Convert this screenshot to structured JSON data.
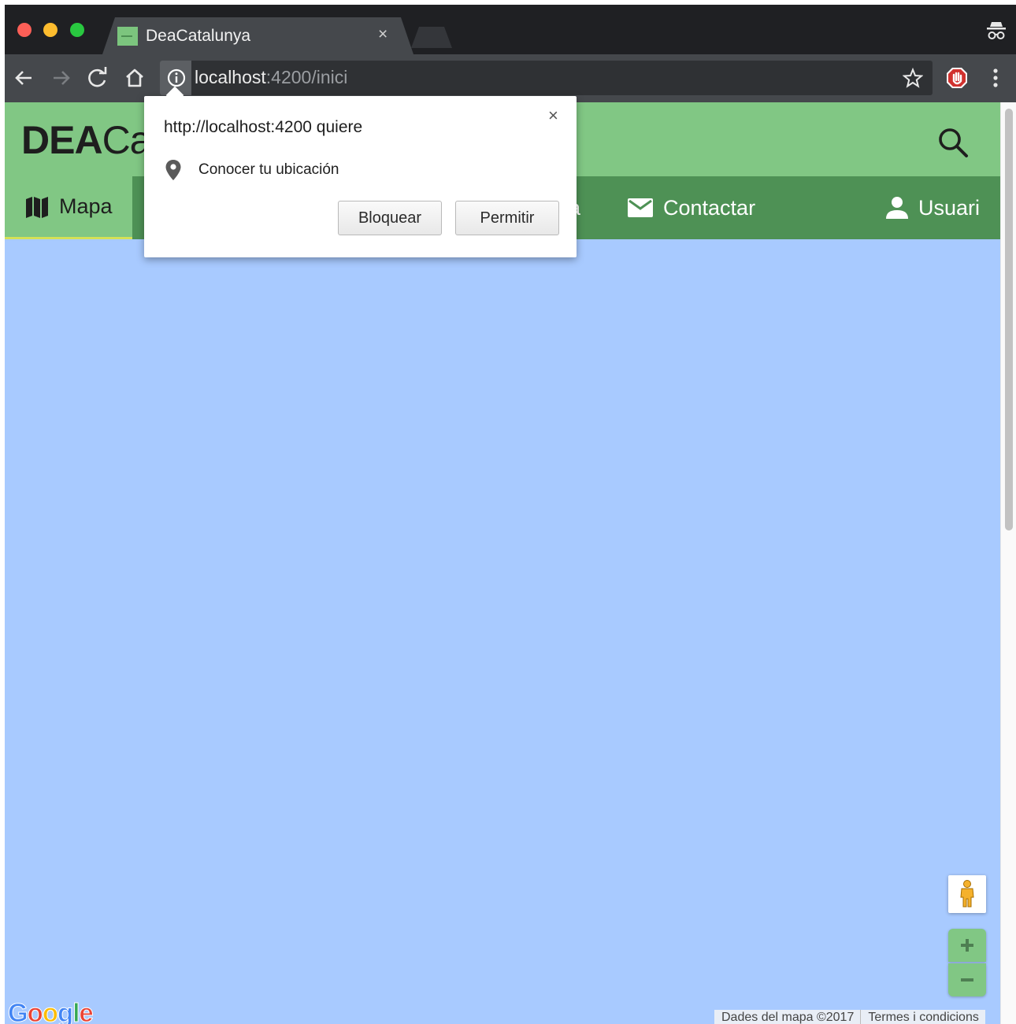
{
  "browser": {
    "tab": {
      "title": "DeaCatalunya",
      "close": "×"
    },
    "address_bar": {
      "host": "localhost",
      "path": ":4200/inici"
    },
    "colors": {
      "titlebar": "#1f2023",
      "toolbar": "#45484c",
      "red": "#fc5f57",
      "yellow": "#fdbc2e",
      "green": "#29c840"
    }
  },
  "app": {
    "logo": {
      "bold": "DEA",
      "light": "Ca"
    },
    "nav": {
      "mapa": "Mapa",
      "partial": "a",
      "contactar": "Contactar",
      "usuari": "Usuari"
    },
    "colors": {
      "header": "#81c784",
      "nav": "#4e9155",
      "map": "#a8caff",
      "active_underline": "#d4e157"
    }
  },
  "map": {
    "zoom_in": "+",
    "zoom_out": "−",
    "google": [
      "G",
      "o",
      "o",
      "g",
      "l",
      "e"
    ],
    "attribution": {
      "data": "Dades del mapa ©2017",
      "terms": "Termes i condicions"
    }
  },
  "permission_prompt": {
    "title": "http://localhost:4200 quiere",
    "close": "×",
    "request": "Conocer tu ubicación",
    "block_label": "Bloquear",
    "allow_label": "Permitir"
  }
}
